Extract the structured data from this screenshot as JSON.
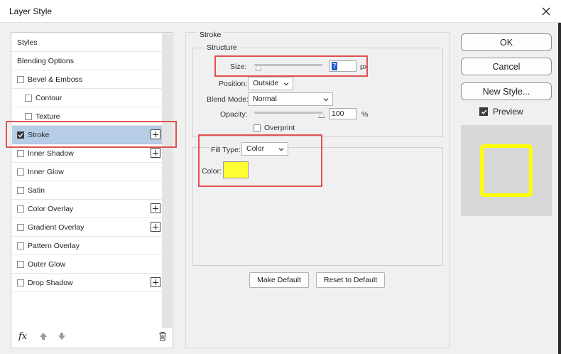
{
  "window": {
    "title": "Layer Style"
  },
  "styles_list": {
    "items": [
      {
        "label": "Styles",
        "has_checkbox": false,
        "checked": false,
        "selected": false,
        "has_plus": false,
        "indent": false
      },
      {
        "label": "Blending Options",
        "has_checkbox": false,
        "checked": false,
        "selected": false,
        "has_plus": false,
        "indent": false
      },
      {
        "label": "Bevel & Emboss",
        "has_checkbox": true,
        "checked": false,
        "selected": false,
        "has_plus": false,
        "indent": false
      },
      {
        "label": "Contour",
        "has_checkbox": true,
        "checked": false,
        "selected": false,
        "has_plus": false,
        "indent": true
      },
      {
        "label": "Texture",
        "has_checkbox": true,
        "checked": false,
        "selected": false,
        "has_plus": false,
        "indent": true
      },
      {
        "label": "Stroke",
        "has_checkbox": true,
        "checked": true,
        "selected": true,
        "has_plus": true,
        "indent": false
      },
      {
        "label": "Inner Shadow",
        "has_checkbox": true,
        "checked": false,
        "selected": false,
        "has_plus": true,
        "indent": false
      },
      {
        "label": "Inner Glow",
        "has_checkbox": true,
        "checked": false,
        "selected": false,
        "has_plus": false,
        "indent": false
      },
      {
        "label": "Satin",
        "has_checkbox": true,
        "checked": false,
        "selected": false,
        "has_plus": false,
        "indent": false
      },
      {
        "label": "Color Overlay",
        "has_checkbox": true,
        "checked": false,
        "selected": false,
        "has_plus": true,
        "indent": false
      },
      {
        "label": "Gradient Overlay",
        "has_checkbox": true,
        "checked": false,
        "selected": false,
        "has_plus": true,
        "indent": false
      },
      {
        "label": "Pattern Overlay",
        "has_checkbox": true,
        "checked": false,
        "selected": false,
        "has_plus": false,
        "indent": false
      },
      {
        "label": "Outer Glow",
        "has_checkbox": true,
        "checked": false,
        "selected": false,
        "has_plus": false,
        "indent": false
      },
      {
        "label": "Drop Shadow",
        "has_checkbox": true,
        "checked": false,
        "selected": false,
        "has_plus": true,
        "indent": false
      }
    ],
    "footer": {
      "fx_label": "fx"
    }
  },
  "stroke": {
    "section_title": "Stroke",
    "structure": {
      "title": "Structure",
      "size_label": "Size:",
      "size_value": "7",
      "size_unit": "px",
      "position_label": "Position:",
      "position_value": "Outside",
      "blend_mode_label": "Blend Mode:",
      "blend_mode_value": "Normal",
      "opacity_label": "Opacity:",
      "opacity_value": "100",
      "opacity_unit": "%",
      "overprint_label": "Overprint"
    },
    "fill": {
      "fill_type_label": "Fill Type:",
      "fill_type_value": "Color",
      "color_label": "Color:",
      "color_hex": "#ffff33"
    },
    "make_default_label": "Make Default",
    "reset_default_label": "Reset to Default"
  },
  "actions": {
    "ok_label": "OK",
    "cancel_label": "Cancel",
    "new_style_label": "New Style...",
    "preview_label": "Preview",
    "preview_checked": true
  },
  "colors": {
    "highlight": "#e05050",
    "selection": "#b7cde6",
    "stroke_color": "#ffff00"
  }
}
